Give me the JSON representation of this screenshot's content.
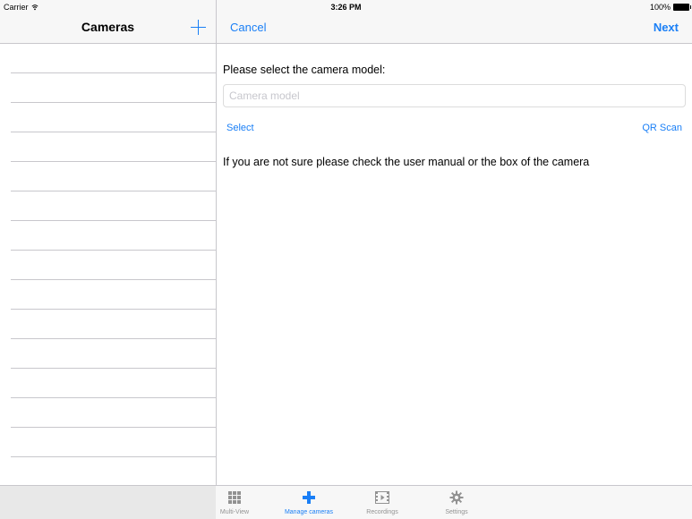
{
  "status_bar": {
    "carrier": "Carrier",
    "time": "3:26 PM",
    "battery": "100%"
  },
  "master": {
    "title": "Cameras",
    "add_icon": "plus-icon",
    "row_count": 15
  },
  "detail": {
    "cancel_label": "Cancel",
    "next_label": "Next",
    "prompt": "Please select the camera model:",
    "model_input": {
      "value": "",
      "placeholder": "Camera model"
    },
    "select_label": "Select",
    "qr_scan_label": "QR Scan",
    "hint": "If you are not sure please check the user manual or the box of the camera"
  },
  "tab_bar": {
    "tabs": [
      {
        "label": "Multi-View",
        "icon": "grid-icon",
        "active": false
      },
      {
        "label": "Manage cameras",
        "icon": "plus-icon",
        "active": true
      },
      {
        "label": "Recordings",
        "icon": "film-icon",
        "active": false
      },
      {
        "label": "Settings",
        "icon": "gear-icon",
        "active": false
      }
    ]
  },
  "colors": {
    "accent": "#1a7ff6",
    "inactive_tab": "#929292",
    "separator": "#c8c7cc",
    "bar_background": "#f7f7f7"
  }
}
